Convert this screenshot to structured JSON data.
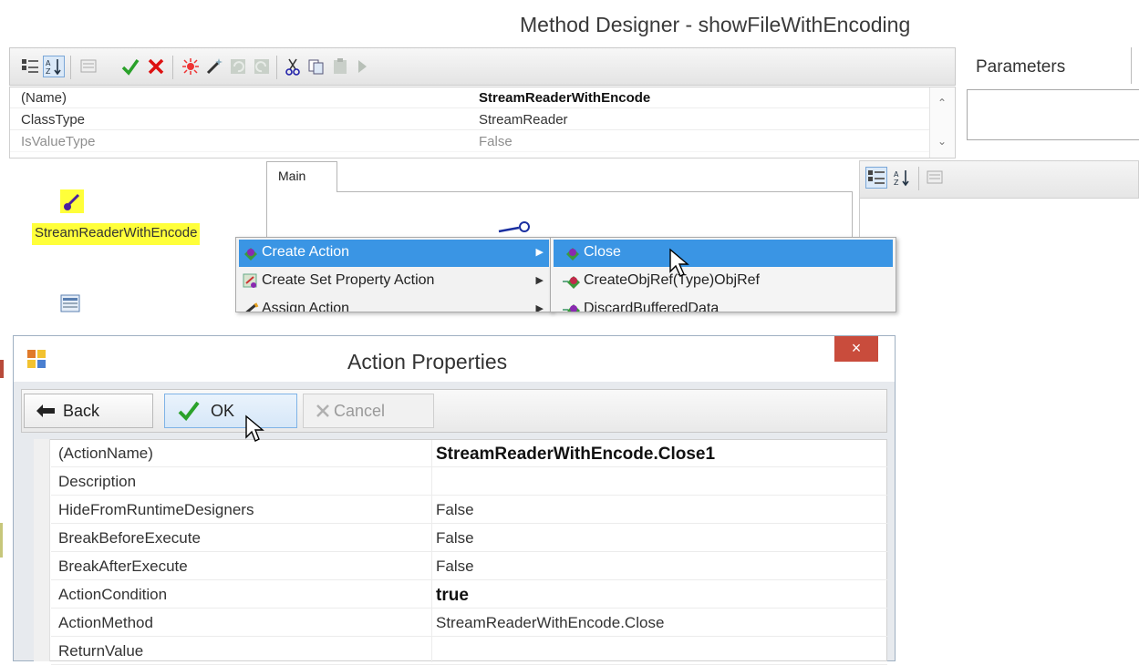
{
  "designer": {
    "title": "Method Designer - showFileWithEncoding",
    "parameters_label": "Parameters",
    "properties": [
      {
        "name": "(Name)",
        "value": "StreamReaderWithEncode",
        "bold": true
      },
      {
        "name": "ClassType",
        "value": "StreamReader"
      },
      {
        "name": "IsValueType",
        "value": "False"
      }
    ],
    "component_label": "StreamReaderWithEncode",
    "tab_main": "Main"
  },
  "context_menu": {
    "items": [
      {
        "label": "Create Action",
        "highlighted": true,
        "has_submenu": true
      },
      {
        "label": "Create Set Property Action",
        "has_submenu": true
      },
      {
        "label": "Assign Action",
        "has_submenu": true
      }
    ],
    "submenu": [
      {
        "label": "Close",
        "highlighted": true
      },
      {
        "label": "CreateObjRef(Type)ObjRef"
      },
      {
        "label": "DiscardBufferedData"
      }
    ]
  },
  "dialog": {
    "title": "Action Properties",
    "close_label": "×",
    "buttons": {
      "back": "Back",
      "ok": "OK",
      "cancel": "Cancel"
    },
    "properties": [
      {
        "name": "(ActionName)",
        "value": "StreamReaderWithEncode.Close1",
        "bold": true
      },
      {
        "name": "Description",
        "value": ""
      },
      {
        "name": "HideFromRuntimeDesigners",
        "value": "False"
      },
      {
        "name": "BreakBeforeExecute",
        "value": "False"
      },
      {
        "name": "BreakAfterExecute",
        "value": "False"
      },
      {
        "name": "ActionCondition",
        "value": "true",
        "bold": true
      },
      {
        "name": "ActionMethod",
        "value": "StreamReaderWithEncode.Close"
      },
      {
        "name": "ReturnValue",
        "value": ""
      }
    ]
  },
  "colors": {
    "menu_highlight": "#3a95e4",
    "component_highlight": "#ffff3a",
    "close_button": "#c94c3c"
  },
  "icons": {
    "toolbar": [
      "categorized-icon",
      "alphabetical-sort-icon",
      "property-pages-icon",
      "check-icon",
      "x-icon",
      "star-burst-icon",
      "magic-wand-icon",
      "undo-icon",
      "redo-icon",
      "cut-icon",
      "copy-icon",
      "paste-icon",
      "run-icon"
    ]
  }
}
